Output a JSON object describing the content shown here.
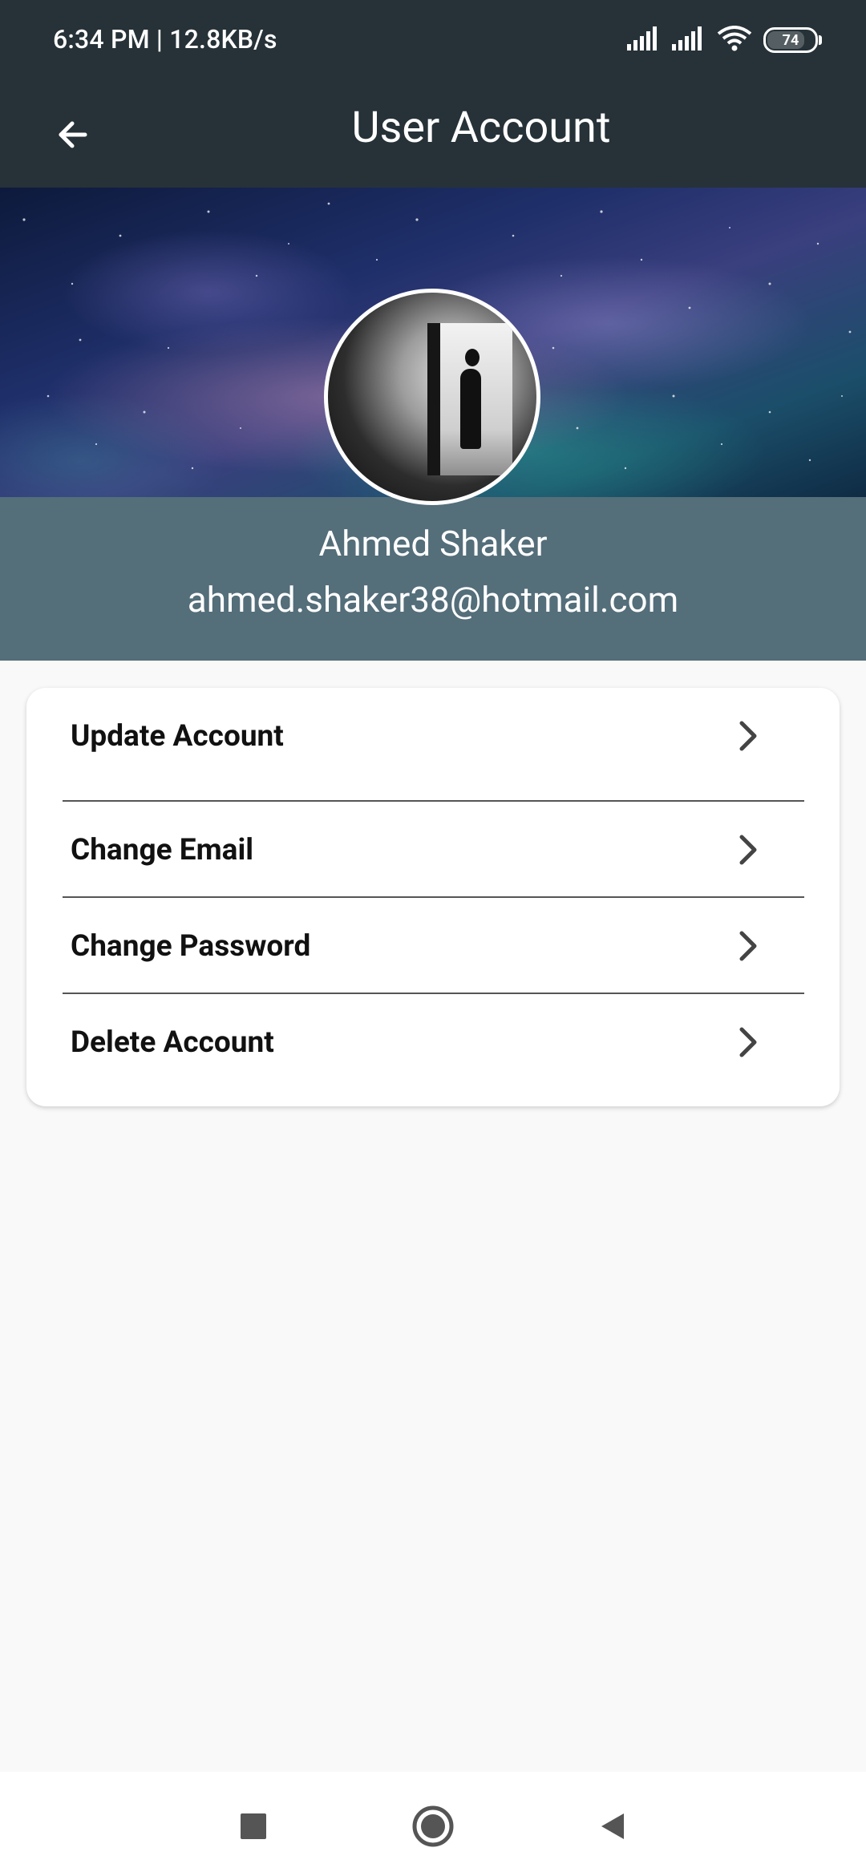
{
  "status_bar": {
    "time_and_speed": "6:34 PM | 12.8KB/s",
    "battery_level": "74",
    "icons": [
      "signal-icon",
      "signal-icon",
      "wifi-icon",
      "battery-icon"
    ]
  },
  "app_bar": {
    "title": "User Account",
    "back_icon": "arrow-left-icon"
  },
  "profile": {
    "name": "Ahmed Shaker",
    "email": "ahmed.shaker38@hotmail.com"
  },
  "menu": {
    "items": [
      {
        "label": "Update Account",
        "icon": "chevron-right-icon"
      },
      {
        "label": "Change Email",
        "icon": "chevron-right-icon"
      },
      {
        "label": "Change Password",
        "icon": "chevron-right-icon"
      },
      {
        "label": "Delete Account",
        "icon": "chevron-right-icon"
      }
    ]
  },
  "nav_bar": {
    "buttons": [
      "recents-square-icon",
      "home-circle-icon",
      "back-triangle-icon"
    ]
  },
  "colors": {
    "app_bar": "#263238",
    "profile_band": "#546e7a",
    "page_background": "#f9f9f9"
  }
}
